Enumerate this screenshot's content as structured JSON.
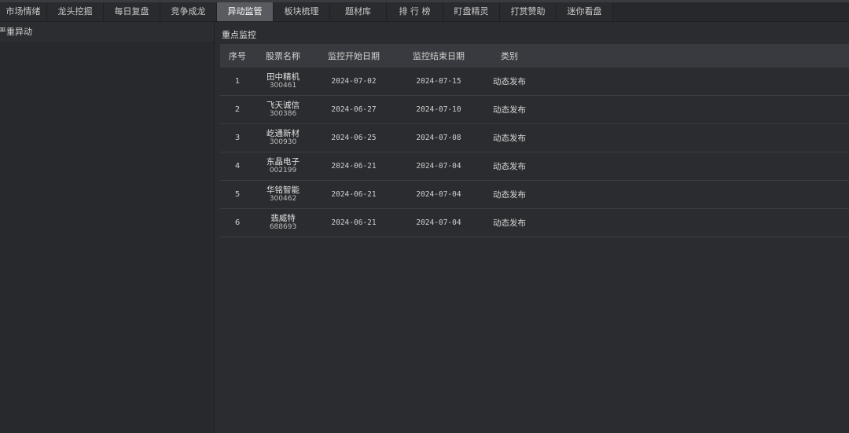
{
  "tabs": [
    {
      "label": "市场情绪",
      "active": false
    },
    {
      "label": "龙头挖掘",
      "active": false
    },
    {
      "label": "每日复盘",
      "active": false
    },
    {
      "label": "竞争成龙",
      "active": false
    },
    {
      "label": "异动监管",
      "active": true
    },
    {
      "label": "板块梳理",
      "active": false
    },
    {
      "label": "题材库",
      "active": false
    },
    {
      "label": "排 行 榜",
      "active": false
    },
    {
      "label": "盯盘精灵",
      "active": false
    },
    {
      "label": "打赏赞助",
      "active": false
    },
    {
      "label": "迷你看盘",
      "active": false
    }
  ],
  "left_panel": {
    "title": "严重异动"
  },
  "main": {
    "title": "重点监控",
    "columns": {
      "index": "序号",
      "name": "股票名称",
      "start": "监控开始日期",
      "end": "监控结束日期",
      "type": "类别"
    },
    "rows": [
      {
        "index": "1",
        "name": "田中精机",
        "code": "300461",
        "start": "2024-07-02",
        "end": "2024-07-15",
        "type": "动态发布"
      },
      {
        "index": "2",
        "name": "飞天诚信",
        "code": "300386",
        "start": "2024-06-27",
        "end": "2024-07-10",
        "type": "动态发布"
      },
      {
        "index": "3",
        "name": "屹通新材",
        "code": "300930",
        "start": "2024-06-25",
        "end": "2024-07-08",
        "type": "动态发布"
      },
      {
        "index": "4",
        "name": "东晶电子",
        "code": "002199",
        "start": "2024-06-21",
        "end": "2024-07-04",
        "type": "动态发布"
      },
      {
        "index": "5",
        "name": "华铭智能",
        "code": "300462",
        "start": "2024-06-21",
        "end": "2024-07-04",
        "type": "动态发布"
      },
      {
        "index": "6",
        "name": "翡威特",
        "code": "688693",
        "start": "2024-06-21",
        "end": "2024-07-04",
        "type": "动态发布"
      }
    ]
  }
}
